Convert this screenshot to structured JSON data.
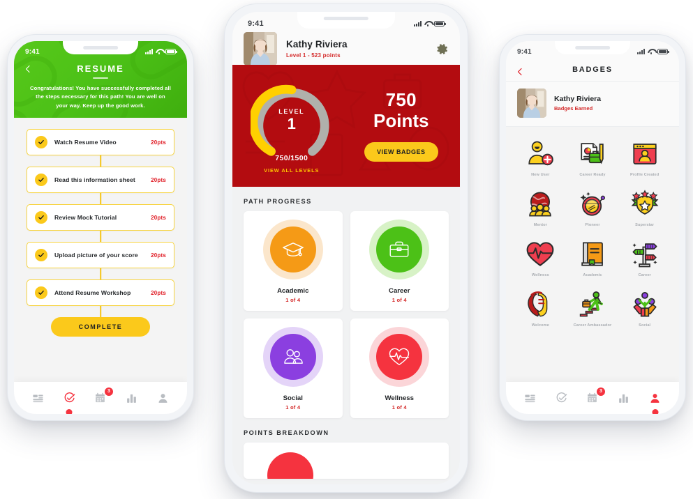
{
  "colors": {
    "green": "#4cc117",
    "yellow": "#fbc91b",
    "red": "#b30c10",
    "accent_red": "#d42a2a",
    "badge_red": "#f5333f",
    "orange": "#f59a16",
    "purple": "#8b3fe0",
    "pink_red": "#f5333f",
    "gray_arc": "#b0b0ab"
  },
  "status_bar": {
    "time": "9:41",
    "signal_icon": "cellular-bars-icon",
    "wifi_icon": "wifi-icon",
    "battery_icon": "battery-icon"
  },
  "left_phone": {
    "header": {
      "back_icon": "back-chevron-icon",
      "title": "RESUME",
      "description": "Congratulations! You have successfully completed all the steps necessary for this path! You are well on your way. Keep up the good work."
    },
    "tasks": [
      {
        "label": "Watch Resume Video",
        "points": "20pts",
        "checked": true
      },
      {
        "label": "Read this information sheet",
        "points": "20pts",
        "checked": true
      },
      {
        "label": "Review Mock Tutorial",
        "points": "20pts",
        "checked": true
      },
      {
        "label": "Upload picture of your score",
        "points": "20pts",
        "checked": true
      },
      {
        "label": "Attend Resume Workshop",
        "points": "20pts",
        "checked": true
      }
    ],
    "complete_button": "COMPLETE",
    "nav": [
      {
        "icon": "dashboard-icon",
        "active": false,
        "badge": null
      },
      {
        "icon": "target-check-icon",
        "active": true,
        "badge": null
      },
      {
        "icon": "calendar-icon",
        "active": false,
        "badge": "3"
      },
      {
        "icon": "bar-chart-icon",
        "active": false,
        "badge": null
      },
      {
        "icon": "person-icon",
        "active": false,
        "badge": null
      }
    ]
  },
  "center_phone": {
    "profile": {
      "avatar_icon": "user-photo",
      "name": "Kathy Riviera",
      "subtitle": "Level 1 - 523 points",
      "settings_icon": "gear-icon"
    },
    "points_card": {
      "gauge_label": "LEVEL",
      "gauge_level": "1",
      "gauge_fraction": "750/1500",
      "gauge_percent": 50,
      "levels_link": "VIEW ALL LEVELS",
      "points_number": "750",
      "points_word": "Points",
      "badges_button": "VIEW BADGES"
    },
    "path_section_title": "PATH PROGRESS",
    "paths": [
      {
        "name": "Academic",
        "progress": "1 of 4",
        "icon": "graduation-cap-icon",
        "color": "#f59a16",
        "ring": "#fbe6cb"
      },
      {
        "name": "Career",
        "progress": "1 of 4",
        "icon": "briefcase-icon",
        "color": "#4cc117",
        "ring": "#d7f2c6"
      },
      {
        "name": "Social",
        "progress": "1 of 4",
        "icon": "people-icon",
        "color": "#8b3fe0",
        "ring": "#e4d4f8"
      },
      {
        "name": "Wellness",
        "progress": "1 of 4",
        "icon": "heart-pulse-icon",
        "color": "#f5333f",
        "ring": "#fbd5d8"
      }
    ],
    "breakdown_section_title": "POINTS BREAKDOWN",
    "nav": [
      {
        "icon": "dashboard-icon",
        "active": false,
        "badge": null
      },
      {
        "icon": "target-check-icon",
        "active": false,
        "badge": null
      },
      {
        "icon": "calendar-icon",
        "active": false,
        "badge": "3"
      },
      {
        "icon": "bar-chart-icon",
        "active": false,
        "badge": null
      },
      {
        "icon": "person-icon",
        "active": false,
        "badge": null
      }
    ]
  },
  "right_phone": {
    "header": {
      "back_icon": "back-chevron-icon",
      "title": "BADGES"
    },
    "user": {
      "avatar_icon": "user-photo",
      "name": "Kathy Riviera",
      "subtitle": "Badges Earned"
    },
    "badges": [
      {
        "label": "New User",
        "icon": "new-user-badge-icon"
      },
      {
        "label": "Career Ready",
        "icon": "career-ready-badge-icon"
      },
      {
        "label": "Profile Created",
        "icon": "profile-created-badge-icon"
      },
      {
        "label": "Mentor",
        "icon": "mentor-badge-icon"
      },
      {
        "label": "Pioneer",
        "icon": "pioneer-badge-icon"
      },
      {
        "label": "Superstar",
        "icon": "superstar-badge-icon"
      },
      {
        "label": "Wellness",
        "icon": "wellness-badge-icon"
      },
      {
        "label": "Academic",
        "icon": "academic-badge-icon"
      },
      {
        "label": "Career",
        "icon": "career-badge-icon"
      },
      {
        "label": "Welcome",
        "icon": "welcome-trojan-badge-icon"
      },
      {
        "label": "Career Ambassador",
        "icon": "career-ambassador-badge-icon"
      },
      {
        "label": "Social",
        "icon": "social-badge-icon"
      }
    ],
    "nav": [
      {
        "icon": "dashboard-icon",
        "active": false,
        "badge": null
      },
      {
        "icon": "target-check-icon",
        "active": false,
        "badge": null
      },
      {
        "icon": "calendar-icon",
        "active": false,
        "badge": "3"
      },
      {
        "icon": "bar-chart-icon",
        "active": false,
        "badge": null
      },
      {
        "icon": "person-icon",
        "active": true,
        "badge": null
      }
    ]
  }
}
